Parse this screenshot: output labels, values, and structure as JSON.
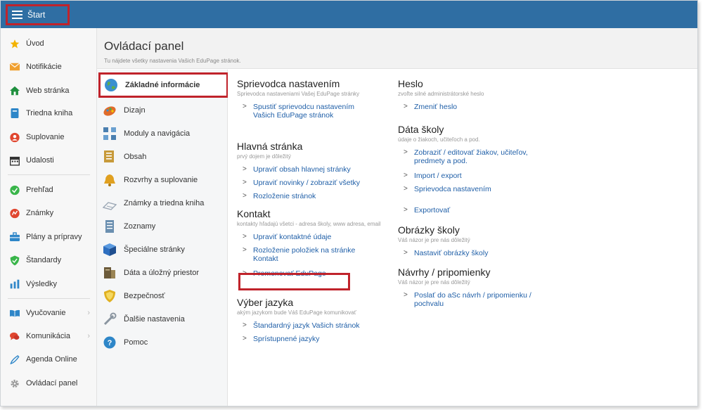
{
  "topbar": {
    "start_label": "Štart"
  },
  "sidebar": {
    "items": [
      {
        "label": "Úvod",
        "icon": "star-icon",
        "color": "#f3b300",
        "chevron": false
      },
      {
        "label": "Notifikácie",
        "icon": "envelope-icon",
        "color": "#f0a030",
        "chevron": false
      },
      {
        "label": "Web stránka",
        "icon": "home-icon",
        "color": "#1f8f3e",
        "chevron": false
      },
      {
        "label": "Triedna kniha",
        "icon": "book-icon",
        "color": "#2e86c8",
        "chevron": false
      },
      {
        "label": "Suplovanie",
        "icon": "user-swap-icon",
        "color": "#e0462f",
        "chevron": false
      },
      {
        "label": "Udalosti",
        "icon": "calendar-icon",
        "color": "#333333",
        "chevron": false
      },
      {
        "label": "Prehľad",
        "icon": "check-circle-icon",
        "color": "#39b54a",
        "chevron": false
      },
      {
        "label": "Známky",
        "icon": "grade-icon",
        "color": "#e0462f",
        "chevron": false
      },
      {
        "label": "Plány a prípravy",
        "icon": "briefcase-icon",
        "color": "#2e86c8",
        "chevron": false
      },
      {
        "label": "Štandardy",
        "icon": "shield-check-icon",
        "color": "#39b54a",
        "chevron": false
      },
      {
        "label": "Výsledky",
        "icon": "bar-chart-icon",
        "color": "#2e86c8",
        "chevron": false
      },
      {
        "label": "Vyučovanie",
        "icon": "open-book-icon",
        "color": "#2e86c8",
        "chevron": true
      },
      {
        "label": "Komunikácia",
        "icon": "chat-icon",
        "color": "#e0462f",
        "chevron": true
      },
      {
        "label": "Agenda Online",
        "icon": "pen-icon",
        "color": "#2e86c8",
        "chevron": false
      },
      {
        "label": "Ovládací panel",
        "icon": "gear-icon",
        "color": "#999999",
        "chevron": false
      }
    ]
  },
  "panel": {
    "title": "Ovládací panel",
    "subtitle": "Tu nájdete všetky nastavenia Vašich EduPage stránok."
  },
  "categories": [
    {
      "label": "Základné informácie",
      "icon": "globe-icon",
      "color": "#3a8fd0",
      "active": true
    },
    {
      "label": "Dizajn",
      "icon": "palette-icon",
      "color": "#e06b2a",
      "active": false
    },
    {
      "label": "Moduly a navigácia",
      "icon": "modules-icon",
      "color": "#4a7fb0",
      "active": false
    },
    {
      "label": "Obsah",
      "icon": "content-icon",
      "color": "#c79a3a",
      "active": false
    },
    {
      "label": "Rozvrhy a suplovanie",
      "icon": "bell-icon",
      "color": "#e0a020",
      "active": false
    },
    {
      "label": "Známky a triedna kniha",
      "icon": "notebook-icon",
      "color": "#9aa6b4",
      "active": false
    },
    {
      "label": "Zoznamy",
      "icon": "list-icon",
      "color": "#6a8fb0",
      "active": false
    },
    {
      "label": "Špeciálne stránky",
      "icon": "cube-icon",
      "color": "#2e6fc0",
      "active": false
    },
    {
      "label": "Dáta a úložný priestor",
      "icon": "storage-icon",
      "color": "#6b5a3a",
      "active": false
    },
    {
      "label": "Bezpečnosť",
      "icon": "shield-icon",
      "color": "#e0b020",
      "active": false
    },
    {
      "label": "Ďalšie nastavenia",
      "icon": "tools-icon",
      "color": "#8a95a0",
      "active": false
    },
    {
      "label": "Pomoc",
      "icon": "help-icon",
      "color": "#2e86c8",
      "active": false
    }
  ],
  "sections": {
    "wizard": {
      "title": "Sprievodca nastavením",
      "desc": "Sprievodca nastaveniami Vašej EduPage stránky",
      "links": [
        "Spustiť sprievodcu nastavením Vašich EduPage stránok"
      ]
    },
    "homepage": {
      "title": "Hlavná stránka",
      "desc": "prvý dojem je dôležitý",
      "links": [
        "Upraviť obsah hlavnej stránky",
        "Upraviť novinky / zobraziť všetky",
        "Rozloženie stránok"
      ]
    },
    "contact": {
      "title": "Kontakt",
      "desc": "kontakty hľadajú všetci - adresa školy, www adresa, email",
      "links": [
        "Upraviť kontaktné údaje",
        "Rozloženie položiek na stránke Kontakt",
        "Premenovať EduPage"
      ]
    },
    "language": {
      "title": "Výber jazyka",
      "desc": "akým jazykom bude Váš EduPage komunikovať",
      "links": [
        "Štandardný jazyk Vašich stránok",
        "Sprístupnené jazyky"
      ]
    },
    "password": {
      "title": "Heslo",
      "desc": "zvoľte silné administrátorské heslo",
      "links": [
        "Zmeniť heslo"
      ]
    },
    "school_data": {
      "title": "Dáta školy",
      "desc": "údaje o žiakoch, učiteľoch a pod.",
      "links": [
        "Zobraziť / editovať žiakov, učiteľov, predmety a pod.",
        "Import / export",
        "Sprievodca nastavením",
        "Exportovať"
      ]
    },
    "images": {
      "title": "Obrázky školy",
      "desc": "Váš názor je pre nás dôležitý",
      "links": [
        "Nastaviť obrázky školy"
      ]
    },
    "suggestions": {
      "title": "Návrhy / pripomienky",
      "desc": "Váš názor je pre nás dôležitý",
      "links": [
        "Poslať do aSc návrh / pripomienku / pochvalu"
      ]
    }
  },
  "link_arrow": ">"
}
